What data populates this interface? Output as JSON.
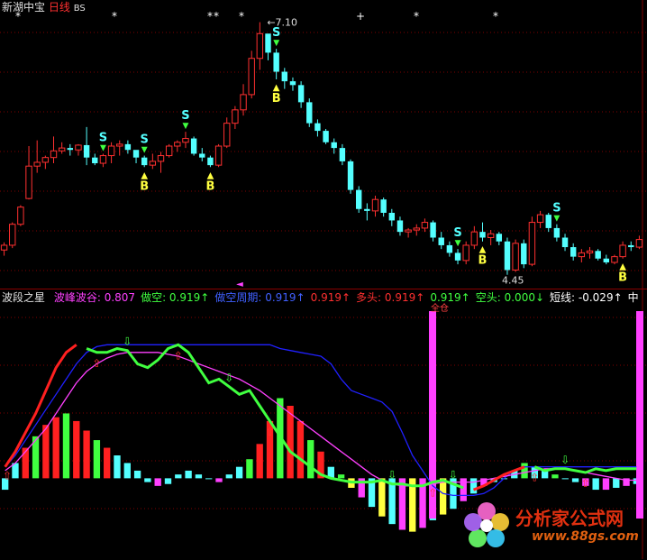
{
  "top_header": {
    "title": "新湖中宝",
    "period": "日线",
    "indicator": "BS"
  },
  "bottom_header": {
    "indicator": "波段之星",
    "items": [
      {
        "label": "波峰波谷:",
        "value": "0.807",
        "color": "#ff40ff",
        "arrow": ""
      },
      {
        "label": "做空:",
        "value": "0.919",
        "color": "#40ff40",
        "arrow": "↑"
      },
      {
        "label": "做空周期:",
        "value": "0.919",
        "color": "#4060ff",
        "arrow": "↑"
      },
      {
        "label": "",
        "value": "0.919",
        "color": "#ff3030",
        "arrow": "↑"
      },
      {
        "label": "多头:",
        "value": "0.919",
        "color": "#ff3030",
        "arrow": "↑"
      },
      {
        "label": "",
        "value": "0.919",
        "color": "#40ff40",
        "arrow": "↑"
      },
      {
        "label": "空头:",
        "value": "0.000",
        "color": "#40ff40",
        "arrow": "↓"
      },
      {
        "label": "短线:",
        "value": "-0.029",
        "color": "#ffffff",
        "arrow": "↑"
      },
      {
        "label": "中",
        "value": "",
        "color": "#ffffff",
        "arrow": ""
      }
    ]
  },
  "annotations": {
    "high_label": "7.10",
    "low_label": "4.45",
    "buy_label": "B",
    "sell_label": "S",
    "bottom_marker": "全仓"
  },
  "colors": {
    "up": "#ff3030",
    "down": "#54ffff",
    "buy": "#ffff40",
    "sell": "#54ffff",
    "grid": "#800000",
    "line_blue": "#2020ff",
    "line_magenta": "#ff40ff",
    "line_green": "#40ff40",
    "line_red": "#ff2020"
  },
  "watermark": {
    "title": "分析家公式网",
    "url": "www.88gs.com"
  },
  "chart_data": [
    {
      "type": "candlestick",
      "title": "",
      "ohlc": [
        [
          4.71,
          4.79,
          4.65,
          4.76
        ],
        [
          4.76,
          5.0,
          4.73,
          4.98
        ],
        [
          4.98,
          5.18,
          4.96,
          5.16
        ],
        [
          5.25,
          5.8,
          5.24,
          5.59
        ],
        [
          5.59,
          5.86,
          5.52,
          5.63
        ],
        [
          5.63,
          5.7,
          5.56,
          5.68
        ],
        [
          5.68,
          5.9,
          5.62,
          5.75
        ],
        [
          5.75,
          5.84,
          5.72,
          5.78
        ],
        [
          5.78,
          5.82,
          5.7,
          5.76
        ],
        [
          5.76,
          5.82,
          5.7,
          5.81
        ],
        [
          5.81,
          6.0,
          5.6,
          5.68
        ],
        [
          5.68,
          5.72,
          5.6,
          5.62
        ],
        [
          5.62,
          5.72,
          5.58,
          5.7
        ],
        [
          5.7,
          5.84,
          5.62,
          5.8
        ],
        [
          5.8,
          5.86,
          5.7,
          5.82
        ],
        [
          5.82,
          5.86,
          5.72,
          5.76
        ],
        [
          5.76,
          5.7,
          5.62,
          5.68
        ],
        [
          5.68,
          5.7,
          5.58,
          5.6
        ],
        [
          5.6,
          5.72,
          5.56,
          5.64
        ],
        [
          5.64,
          5.74,
          5.52,
          5.7
        ],
        [
          5.7,
          5.82,
          5.68,
          5.8
        ],
        [
          5.8,
          5.86,
          5.74,
          5.84
        ],
        [
          5.84,
          5.95,
          5.78,
          5.88
        ],
        [
          5.88,
          5.9,
          5.7,
          5.72
        ],
        [
          5.72,
          5.78,
          5.64,
          5.68
        ],
        [
          5.68,
          5.7,
          5.58,
          5.6
        ],
        [
          5.6,
          5.82,
          5.58,
          5.8
        ],
        [
          5.8,
          6.1,
          5.78,
          6.04
        ],
        [
          6.04,
          6.22,
          5.98,
          6.18
        ],
        [
          6.18,
          6.45,
          6.12,
          6.34
        ],
        [
          6.34,
          6.8,
          6.3,
          6.72
        ],
        [
          6.72,
          7.1,
          6.6,
          6.98
        ],
        [
          6.98,
          6.9,
          6.7,
          6.78
        ],
        [
          6.78,
          6.82,
          6.5,
          6.58
        ],
        [
          6.58,
          6.62,
          6.4,
          6.48
        ],
        [
          6.48,
          6.52,
          6.38,
          6.44
        ],
        [
          6.44,
          6.48,
          6.2,
          6.26
        ],
        [
          6.26,
          6.3,
          6.0,
          6.04
        ],
        [
          6.04,
          6.08,
          5.9,
          5.96
        ],
        [
          5.96,
          5.98,
          5.82,
          5.84
        ],
        [
          5.84,
          5.88,
          5.72,
          5.78
        ],
        [
          5.78,
          5.82,
          5.6,
          5.64
        ],
        [
          5.64,
          5.66,
          5.3,
          5.34
        ],
        [
          5.34,
          5.38,
          5.1,
          5.14
        ],
        [
          5.14,
          5.2,
          5.02,
          5.12
        ],
        [
          5.12,
          5.28,
          5.06,
          5.24
        ],
        [
          5.24,
          5.26,
          5.06,
          5.1
        ],
        [
          5.1,
          5.14,
          4.96,
          5.02
        ],
        [
          5.02,
          5.06,
          4.86,
          4.9
        ],
        [
          4.9,
          4.94,
          4.84,
          4.92
        ],
        [
          4.92,
          4.98,
          4.86,
          4.94
        ],
        [
          4.94,
          5.04,
          4.9,
          5.0
        ],
        [
          5.0,
          5.02,
          4.8,
          4.84
        ],
        [
          4.84,
          4.9,
          4.72,
          4.76
        ],
        [
          4.76,
          4.8,
          4.64,
          4.68
        ],
        [
          4.68,
          4.72,
          4.56,
          4.6
        ],
        [
          4.6,
          4.8,
          4.56,
          4.76
        ],
        [
          4.76,
          4.96,
          4.72,
          4.9
        ],
        [
          4.9,
          5.0,
          4.8,
          4.84
        ],
        [
          4.84,
          4.92,
          4.76,
          4.88
        ],
        [
          4.88,
          4.9,
          4.76,
          4.8
        ],
        [
          4.8,
          4.84,
          4.45,
          4.5
        ],
        [
          4.5,
          4.82,
          4.48,
          4.78
        ],
        [
          4.78,
          4.82,
          4.52,
          4.56
        ],
        [
          4.56,
          5.06,
          4.54,
          5.0
        ],
        [
          5.0,
          5.12,
          4.94,
          5.08
        ],
        [
          5.08,
          5.1,
          4.9,
          4.94
        ],
        [
          4.94,
          4.98,
          4.8,
          4.84
        ],
        [
          4.84,
          4.88,
          4.7,
          4.74
        ],
        [
          4.74,
          4.78,
          4.6,
          4.64
        ],
        [
          4.64,
          4.72,
          4.58,
          4.68
        ],
        [
          4.68,
          4.74,
          4.62,
          4.7
        ],
        [
          4.7,
          4.72,
          4.6,
          4.62
        ],
        [
          4.62,
          4.66,
          4.56,
          4.58
        ],
        [
          4.58,
          4.66,
          4.56,
          4.64
        ],
        [
          4.64,
          4.8,
          4.62,
          4.76
        ],
        [
          4.76,
          4.8,
          4.7,
          4.74
        ],
        [
          4.74,
          4.86,
          4.72,
          4.82
        ]
      ],
      "y_range": [
        4.4,
        7.2
      ],
      "buy_signals": [
        17,
        25,
        33,
        58,
        75
      ],
      "sell_signals": [
        12,
        17,
        22,
        33,
        55,
        67
      ]
    },
    {
      "type": "line",
      "title": "",
      "y_range": [
        -0.4,
        0.9
      ],
      "series": [
        {
          "name": "做空周期",
          "color": "#2020ff",
          "values": [
            0.06,
            0.12,
            0.2,
            0.28,
            0.36,
            0.44,
            0.52,
            0.6,
            0.66,
            0.69,
            0.7,
            0.7,
            0.7,
            0.7,
            0.7,
            0.7,
            0.7,
            0.7,
            0.7,
            0.7,
            0.7,
            0.7,
            0.7,
            0.7,
            0.7,
            0.7,
            0.7,
            0.68,
            0.67,
            0.66,
            0.65,
            0.64,
            0.6,
            0.52,
            0.46,
            0.44,
            0.42,
            0.4,
            0.35,
            0.24,
            0.12,
            0.04,
            -0.04,
            -0.08,
            -0.09,
            -0.09,
            -0.09,
            -0.08,
            -0.05,
            0.0,
            0.04,
            0.06,
            0.06,
            0.06,
            0.06,
            0.06,
            0.06,
            0.06,
            0.06,
            0.06,
            0.06,
            0.06,
            0.06
          ]
        },
        {
          "name": "波峰波谷",
          "color": "#ff40ff",
          "values": [
            0.04,
            0.08,
            0.14,
            0.2,
            0.26,
            0.34,
            0.42,
            0.5,
            0.56,
            0.6,
            0.63,
            0.65,
            0.66,
            0.66,
            0.66,
            0.66,
            0.65,
            0.64,
            0.62,
            0.6,
            0.58,
            0.56,
            0.54,
            0.52,
            0.49,
            0.46,
            0.42,
            0.38,
            0.34,
            0.3,
            0.26,
            0.22,
            0.18,
            0.14,
            0.1,
            0.06,
            0.02,
            -0.01,
            -0.03,
            -0.04,
            -0.04,
            -0.04,
            -0.03,
            -0.02,
            -0.02,
            -0.02,
            -0.02,
            -0.01,
            0.0,
            0.01,
            0.02,
            0.03,
            0.04,
            0.05,
            0.05,
            0.05,
            0.04,
            0.03,
            0.02,
            0.01,
            0.0,
            -0.01,
            -0.01
          ]
        },
        {
          "name": "做空",
          "color": "#40ff40",
          "values": [
            null,
            null,
            null,
            null,
            null,
            null,
            null,
            null,
            0.68,
            0.66,
            0.66,
            0.68,
            0.67,
            0.6,
            0.58,
            0.62,
            0.68,
            0.7,
            0.66,
            0.58,
            0.5,
            0.52,
            0.48,
            0.44,
            0.46,
            0.38,
            0.3,
            0.22,
            0.14,
            0.1,
            0.06,
            0.02,
            0.0,
            -0.01,
            -0.02,
            -0.02,
            -0.02,
            -0.01,
            -0.03,
            -0.03,
            -0.04,
            -0.04,
            -0.02,
            -0.01,
            -0.03,
            -0.05,
            null,
            null,
            null,
            null,
            null,
            null,
            0.06,
            0.04,
            0.05,
            0.05,
            0.04,
            0.03,
            0.05,
            0.04,
            0.05,
            0.05,
            0.05
          ]
        },
        {
          "name": "多头",
          "color": "#ff2020",
          "values": [
            0.06,
            0.14,
            0.24,
            0.34,
            0.46,
            0.58,
            0.66,
            0.7,
            null,
            null,
            null,
            null,
            null,
            null,
            null,
            null,
            null,
            null,
            null,
            null,
            null,
            null,
            null,
            null,
            null,
            null,
            null,
            null,
            null,
            null,
            null,
            null,
            null,
            null,
            null,
            null,
            null,
            null,
            null,
            null,
            null,
            null,
            null,
            null,
            null,
            null,
            -0.06,
            -0.04,
            -0.01,
            0.02,
            0.04,
            0.06,
            null,
            null,
            null,
            null,
            null,
            null,
            null,
            null,
            null,
            null,
            null
          ]
        }
      ],
      "bars": {
        "name": "短线",
        "values": [
          -0.06,
          0.08,
          0.16,
          0.22,
          0.28,
          0.32,
          0.34,
          0.3,
          0.25,
          0.2,
          0.16,
          0.12,
          0.08,
          0.04,
          -0.02,
          -0.04,
          -0.03,
          0.02,
          0.04,
          0.02,
          0.0,
          -0.02,
          0.02,
          0.06,
          0.1,
          0.18,
          0.3,
          0.42,
          0.38,
          0.3,
          0.2,
          0.14,
          0.06,
          0.02,
          -0.05,
          -0.1,
          -0.15,
          -0.2,
          -0.24,
          -0.27,
          -0.28,
          -0.26,
          -0.22,
          -0.19,
          -0.16,
          -0.12,
          -0.08,
          -0.04,
          -0.02,
          0.0,
          0.04,
          0.08,
          0.06,
          0.04,
          0.02,
          0.0,
          -0.02,
          -0.04,
          -0.06,
          -0.06,
          -0.05,
          -0.04,
          -0.03
        ]
      }
    }
  ]
}
